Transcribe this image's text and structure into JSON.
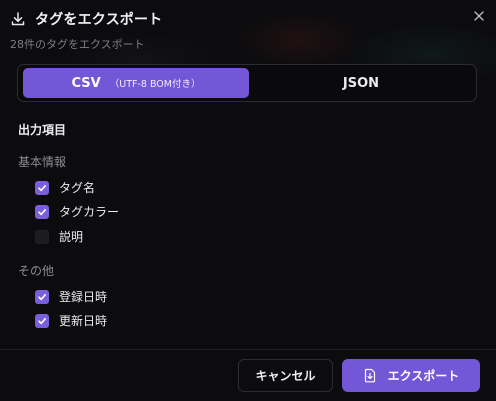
{
  "dialog": {
    "title": "タグをエクスポート",
    "subtitle": "28件のタグをエクスポート",
    "icon": "download-icon",
    "close_icon": "close-icon"
  },
  "format": {
    "options": [
      {
        "label": "CSV",
        "note": "（UTF-8 BOM付き）",
        "selected": true
      },
      {
        "label": "JSON",
        "selected": false
      }
    ]
  },
  "fields": {
    "title": "出力項目",
    "groups": [
      {
        "label": "基本情報",
        "items": [
          {
            "label": "タグ名",
            "checked": true
          },
          {
            "label": "タグカラー",
            "checked": true
          },
          {
            "label": "説明",
            "checked": false
          }
        ]
      },
      {
        "label": "その他",
        "items": [
          {
            "label": "登録日時",
            "checked": true
          },
          {
            "label": "更新日時",
            "checked": true
          }
        ]
      }
    ]
  },
  "footer": {
    "cancel_label": "キャンセル",
    "export_label": "エクスポート",
    "export_icon": "file-export-icon"
  },
  "colors": {
    "accent": "#7457d6",
    "background": "#0c0c0e",
    "text": "#ececef",
    "muted": "#8a8a93"
  }
}
